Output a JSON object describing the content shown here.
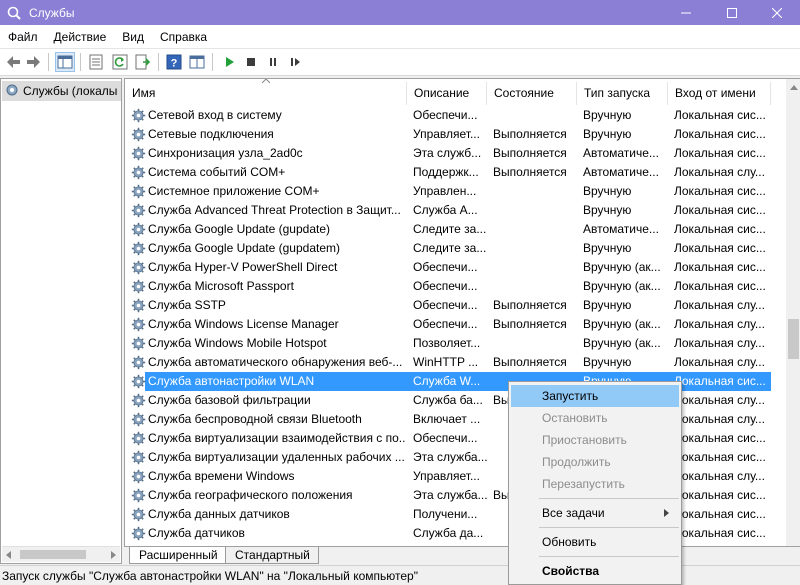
{
  "window": {
    "title": "Службы",
    "accent": "#8a7fd4"
  },
  "menu": [
    "Файл",
    "Действие",
    "Вид",
    "Справка"
  ],
  "toolbar": {
    "buttons": [
      "back-icon",
      "forward-icon",
      "console-tree-icon",
      "properties-icon",
      "refresh-icon",
      "export-list-icon",
      "help-icon",
      "view-icon",
      "start-service-icon",
      "stop-service-icon",
      "pause-service-icon",
      "resume-service-icon"
    ]
  },
  "tree": {
    "root_label": "Службы (локалы"
  },
  "columns": {
    "name": "Имя",
    "desc": "Описание",
    "state": "Состояние",
    "type": "Тип запуска",
    "logon": "Вход от имени"
  },
  "rows": [
    {
      "name": "Сетевой вход в систему",
      "desc": "Обеспечи...",
      "state": "",
      "type": "Вручную",
      "logon": "Локальная сис..."
    },
    {
      "name": "Сетевые подключения",
      "desc": "Управляет...",
      "state": "Выполняется",
      "type": "Вручную",
      "logon": "Локальная сис..."
    },
    {
      "name": "Синхронизация узла_2ad0c",
      "desc": "Эта служб...",
      "state": "Выполняется",
      "type": "Автоматиче...",
      "logon": "Локальная сис..."
    },
    {
      "name": "Система событий COM+",
      "desc": "Поддержк...",
      "state": "Выполняется",
      "type": "Автоматиче...",
      "logon": "Локальная слу..."
    },
    {
      "name": "Системное приложение COM+",
      "desc": "Управлен...",
      "state": "",
      "type": "Вручную",
      "logon": "Локальная сис..."
    },
    {
      "name": "Служба Advanced Threat Protection в Защит...",
      "desc": "Служба А...",
      "state": "",
      "type": "Вручную",
      "logon": "Локальная сис..."
    },
    {
      "name": "Служба Google Update (gupdate)",
      "desc": "Следите за...",
      "state": "",
      "type": "Автоматиче...",
      "logon": "Локальная сис..."
    },
    {
      "name": "Служба Google Update (gupdatem)",
      "desc": "Следите за...",
      "state": "",
      "type": "Вручную",
      "logon": "Локальная сис..."
    },
    {
      "name": "Служба Hyper-V PowerShell Direct",
      "desc": "Обеспечи...",
      "state": "",
      "type": "Вручную (ак...",
      "logon": "Локальная сис..."
    },
    {
      "name": "Служба Microsoft Passport",
      "desc": "Обеспечи...",
      "state": "",
      "type": "Вручную (ак...",
      "logon": "Локальная сис..."
    },
    {
      "name": "Служба SSTP",
      "desc": "Обеспечи...",
      "state": "Выполняется",
      "type": "Вручную",
      "logon": "Локальная слу..."
    },
    {
      "name": "Служба Windows License Manager",
      "desc": "Обеспечи...",
      "state": "Выполняется",
      "type": "Вручную (ак...",
      "logon": "Локальная слу..."
    },
    {
      "name": "Служба Windows Mobile Hotspot",
      "desc": "Позволяет...",
      "state": "",
      "type": "Вручную (ак...",
      "logon": "Локальная слу..."
    },
    {
      "name": "Служба автоматического обнаружения веб-...",
      "desc": "WinHTTP ...",
      "state": "Выполняется",
      "type": "Вручную",
      "logon": "Локальная слу..."
    },
    {
      "name": "Служба автонастройки WLAN",
      "desc": "Служба W...",
      "state": "",
      "type": "Вручную",
      "logon": "Локальная сис...",
      "selected": true
    },
    {
      "name": "Служба базовой фильтрации",
      "desc": "Служба ба...",
      "state": "Вы",
      "type": "",
      "logon": "Локальная слу..."
    },
    {
      "name": "Служба беспроводной связи Bluetooth",
      "desc": "Включает ...",
      "state": "",
      "type": "",
      "logon": "Локальная слу..."
    },
    {
      "name": "Служба виртуализации взаимодействия с по...",
      "desc": "Обеспечи...",
      "state": "",
      "type": "",
      "logon": "Локальная сис..."
    },
    {
      "name": "Служба виртуализации удаленных рабочих ...",
      "desc": "Эта служба...",
      "state": "",
      "type": "",
      "logon": "Локальная сис..."
    },
    {
      "name": "Служба времени Windows",
      "desc": "Управляет...",
      "state": "",
      "type": "",
      "logon": "Локальная слу..."
    },
    {
      "name": "Служба географического положения",
      "desc": "Эта служба...",
      "state": "Вы",
      "type": "",
      "logon": "Локальная сис..."
    },
    {
      "name": "Служба данных датчиков",
      "desc": "Получени...",
      "state": "",
      "type": "",
      "logon": "Локальная сис..."
    },
    {
      "name": "Служба датчиков",
      "desc": "Служба да...",
      "state": "",
      "type": "",
      "logon": "Локальная сис..."
    }
  ],
  "tabs": {
    "extended": "Расширенный",
    "standard": "Стандартный"
  },
  "status": "Запуск службы \"Служба автонастройки WLAN\" на \"Локальный компьютер\"",
  "context_menu": {
    "start": "Запустить",
    "stop": "Остановить",
    "pause": "Приостановить",
    "resume": "Продолжить",
    "restart": "Перезапустить",
    "all_tasks": "Все задачи",
    "refresh": "Обновить",
    "properties": "Свойства"
  },
  "colors": {
    "selection": "#3399ff",
    "menu_highlight": "#91c9f7",
    "disabled_text": "#8c8c8c"
  }
}
